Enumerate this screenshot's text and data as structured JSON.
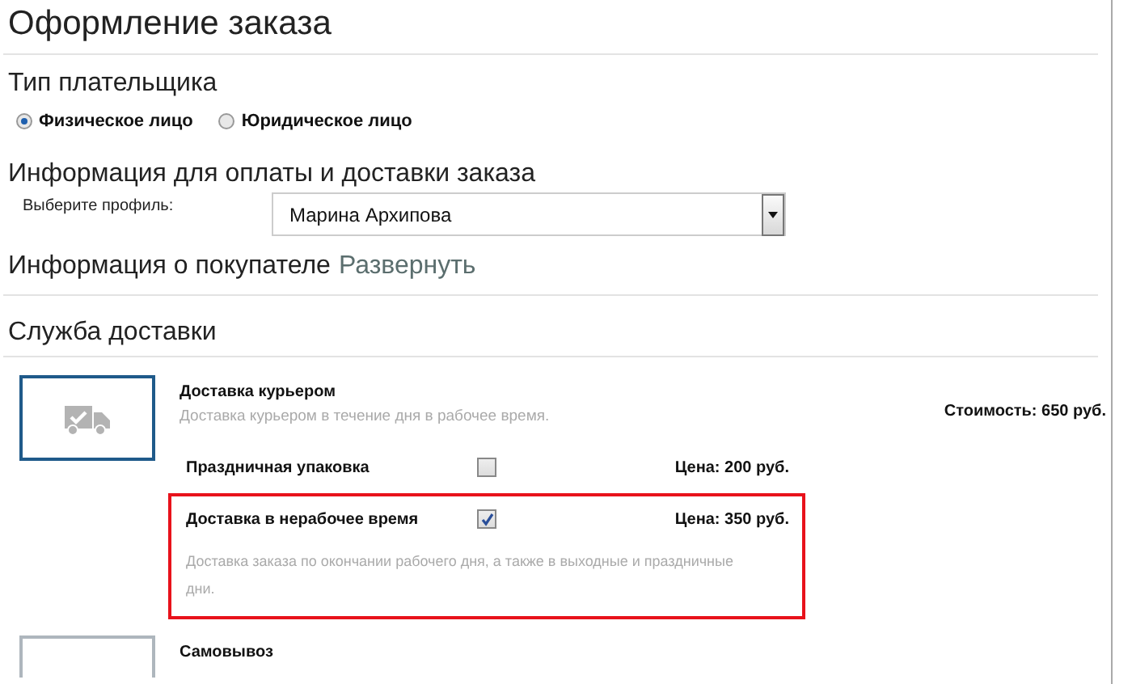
{
  "page_title": "Оформление заказа",
  "payer_type": {
    "heading": "Тип плательщика",
    "options": [
      {
        "label": "Физическое лицо",
        "selected": true
      },
      {
        "label": "Юридическое лицо",
        "selected": false
      }
    ]
  },
  "payment_info": {
    "heading": "Информация для оплаты и доставки заказа",
    "profile_label": "Выберите профиль:",
    "profile_value": "Марина Архипова"
  },
  "buyer_info": {
    "heading": "Информация о покупателе",
    "link": "Развернуть"
  },
  "delivery": {
    "heading": "Служба доставки",
    "services": [
      {
        "title": "Доставка курьером",
        "description": "Доставка курьером в течение дня в рабочее время.",
        "cost": "Стоимость: 650 руб.",
        "selected": true,
        "options": [
          {
            "label": "Праздничная упаковка",
            "checked": false,
            "price": "Цена: 200 руб.",
            "highlighted": false
          },
          {
            "label": "Доставка в нерабочее время",
            "checked": true,
            "price": "Цена: 350 руб.",
            "highlighted": true,
            "description": "Доставка заказа по окончании рабочего дня, а также в выходные и праздничные дни."
          }
        ]
      },
      {
        "title": "Самовывоз",
        "selected": false
      }
    ]
  }
}
